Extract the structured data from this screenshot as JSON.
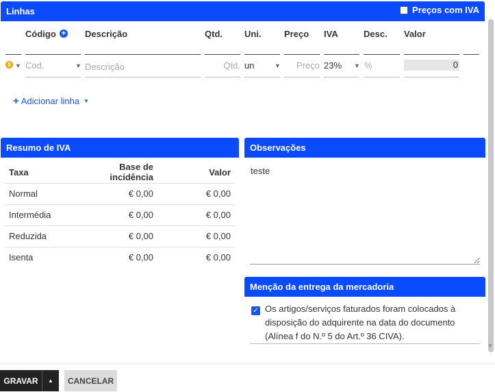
{
  "lines_panel": {
    "title": "Linhas",
    "precos_com_iva_label": "Preços com IVA",
    "precos_com_iva_checked": false,
    "columns": {
      "codigo": "Código",
      "descricao": "Descrição",
      "qtd": "Qtd.",
      "uni": "Uni.",
      "preco": "Preço",
      "iva": "IVA",
      "desc": "Desc.",
      "valor": "Valor"
    },
    "row": {
      "codigo_placeholder": "Cod.",
      "descricao_placeholder": "Descrição",
      "qtd_placeholder": "Qtd.",
      "uni_value": "un",
      "preco_placeholder": "Preço",
      "iva_value": "23%",
      "desc_placeholder": "%",
      "valor_value": "0"
    },
    "add_line_label": "Adicionar linha"
  },
  "iva_summary": {
    "title": "Resumo de IVA",
    "headers": {
      "taxa": "Taxa",
      "base": "Base de incidência",
      "valor": "Valor"
    },
    "rows": [
      {
        "taxa": "Normal",
        "base": "€ 0,00",
        "valor": "€ 0,00"
      },
      {
        "taxa": "Intermédia",
        "base": "€ 0,00",
        "valor": "€ 0,00"
      },
      {
        "taxa": "Reduzida",
        "base": "€ 0,00",
        "valor": "€ 0,00"
      },
      {
        "taxa": "Isenta",
        "base": "€ 0,00",
        "valor": "€ 0,00"
      }
    ]
  },
  "observacoes": {
    "title": "Observações",
    "value": "teste"
  },
  "mencao": {
    "title": "Menção da entrega da mercadoria",
    "checked": true,
    "text": "Os artigos/serviços faturados foram colocados à disposição do adquirente na data do documento (Alínea f do N.º 5 do Art.º 36 CIVA)."
  },
  "footer": {
    "gravar_label": "GRAVAR",
    "cancelar_label": "CANCELAR"
  },
  "colors": {
    "panel_header": "#0a4bff",
    "link": "#1a55e6",
    "primary_button": "#222222",
    "secondary_button": "#dcdcdc"
  }
}
